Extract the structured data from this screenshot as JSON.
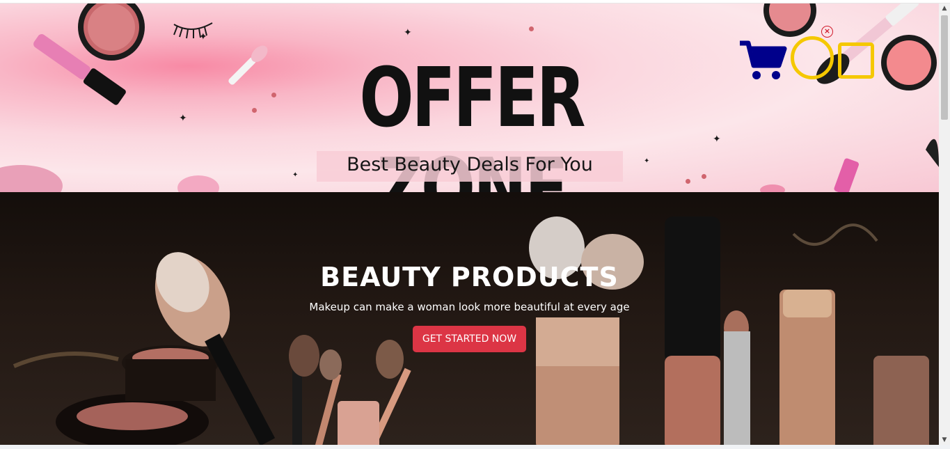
{
  "offer_banner": {
    "title": "OFFER ZONE",
    "subtitle": "Best Beauty Deals For You"
  },
  "header": {
    "icons": {
      "cart": "shopping-cart-icon",
      "close": "close-icon"
    },
    "close_symbol": "×"
  },
  "hero": {
    "title": "BEAUTY PRODUCTS",
    "tagline": "Makeup can make a woman look more beautiful at every age",
    "cta_label": "GET STARTED NOW"
  },
  "scrollbar": {
    "up_arrow": "▲",
    "down_arrow": "▼"
  },
  "colors": {
    "cta_background": "#dc3545",
    "cart_icon": "#00008b",
    "highlight": "#f5c800",
    "close_badge": "#d11a2a"
  }
}
